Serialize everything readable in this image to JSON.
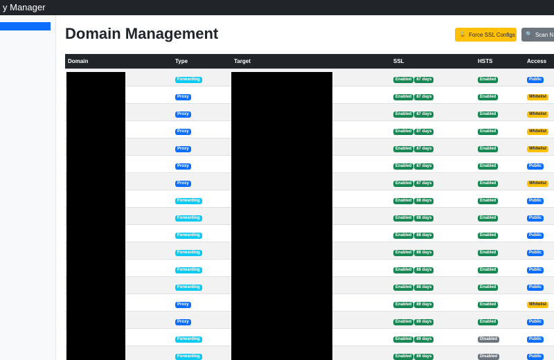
{
  "app": {
    "title": "y Manager"
  },
  "page": {
    "title": "Domain Management"
  },
  "actions": {
    "force_ssl_label": "Force SSL Configs",
    "scan_label": "Scan N"
  },
  "table": {
    "columns": [
      "Domain",
      "Type",
      "Target",
      "SSL",
      "HSTS",
      "Access"
    ],
    "rows": [
      {
        "type": "Forwarding",
        "ssl": "Enabled",
        "expiry": "87 days",
        "hsts": "Enabled",
        "access": "Public"
      },
      {
        "type": "Proxy",
        "ssl": "Enabled",
        "expiry": "87 days",
        "hsts": "Enabled",
        "access": "Whitelist"
      },
      {
        "type": "Proxy",
        "ssl": "Enabled",
        "expiry": "87 days",
        "hsts": "Enabled",
        "access": "Whitelist"
      },
      {
        "type": "Proxy",
        "ssl": "Enabled",
        "expiry": "87 days",
        "hsts": "Enabled",
        "access": "Whitelist"
      },
      {
        "type": "Proxy",
        "ssl": "Enabled",
        "expiry": "87 days",
        "hsts": "Enabled",
        "access": "Whitelist"
      },
      {
        "type": "Proxy",
        "ssl": "Enabled",
        "expiry": "87 days",
        "hsts": "Enabled",
        "access": "Public"
      },
      {
        "type": "Proxy",
        "ssl": "Enabled",
        "expiry": "87 days",
        "hsts": "Enabled",
        "access": "Whitelist"
      },
      {
        "type": "Forwarding",
        "ssl": "Enabled",
        "expiry": "88 days",
        "hsts": "Enabled",
        "access": "Public"
      },
      {
        "type": "Forwarding",
        "ssl": "Enabled",
        "expiry": "88 days",
        "hsts": "Enabled",
        "access": "Public"
      },
      {
        "type": "Forwarding",
        "ssl": "Enabled",
        "expiry": "88 days",
        "hsts": "Enabled",
        "access": "Public"
      },
      {
        "type": "Forwarding",
        "ssl": "Enabled",
        "expiry": "88 days",
        "hsts": "Enabled",
        "access": "Public"
      },
      {
        "type": "Forwarding",
        "ssl": "Enabled",
        "expiry": "88 days",
        "hsts": "Enabled",
        "access": "Public"
      },
      {
        "type": "Forwarding",
        "ssl": "Enabled",
        "expiry": "88 days",
        "hsts": "Enabled",
        "access": "Public"
      },
      {
        "type": "Proxy",
        "ssl": "Enabled",
        "expiry": "89 days",
        "hsts": "Enabled",
        "access": "Whitelist"
      },
      {
        "type": "Proxy",
        "ssl": "Enabled",
        "expiry": "89 days",
        "hsts": "Enabled",
        "access": "Public"
      },
      {
        "type": "Forwarding",
        "ssl": "Enabled",
        "expiry": "89 days",
        "hsts": "Disabled",
        "access": "Public"
      },
      {
        "type": "Forwarding",
        "ssl": "Enabled",
        "expiry": "89 days",
        "hsts": "Disabled",
        "access": "Public"
      }
    ]
  },
  "colors": {
    "forwarding": "#0dcaf0",
    "proxy": "#0d6efd",
    "enabled": "#198754",
    "disabled": "#6c757d",
    "public": "#0d6efd",
    "whitelist": "#ffc107",
    "header_bg": "#212529"
  },
  "icons": {
    "force_ssl": "lock-icon",
    "scan": "search-icon"
  }
}
